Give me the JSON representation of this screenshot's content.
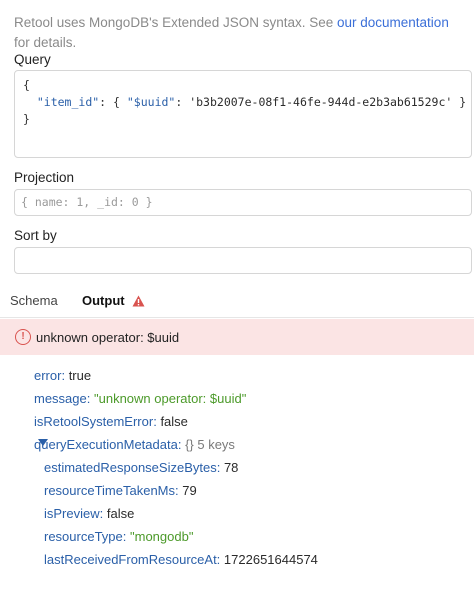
{
  "intro": {
    "text_before": "Retool uses MongoDB's Extended JSON syntax. See ",
    "link": "our documentation",
    "text_after": " for details."
  },
  "query": {
    "label": "Query",
    "lines": [
      "{",
      "  \"item_id\": { \"$uuid\": 'b3b2007e-08f1-46fe-944d-e2b3ab61529c' }",
      "}"
    ],
    "open_brace": "{",
    "key": "\"item_id\"",
    "colon_brace": ": { ",
    "op": "\"$uuid\"",
    "colon": ": ",
    "value": "'b3b2007e-08f1-46fe-944d-e2b3ab61529c'",
    "close_inner": " }",
    "close_brace": "}"
  },
  "projection": {
    "label": "Projection",
    "placeholder": "{ name: 1, _id: 0 }"
  },
  "sort": {
    "label": "Sort by",
    "value": ""
  },
  "tabs": {
    "schema": "Schema",
    "output": "Output"
  },
  "error": {
    "icon": "!",
    "message": "unknown operator: $uuid"
  },
  "output": {
    "error_key": "error:",
    "error_val": "true",
    "message_key": "message:",
    "message_val": "\"unknown operator: $uuid\"",
    "isRetool_key": "isRetoolSystemError:",
    "isRetool_val": "false",
    "qem_key": "queryExecutionMetadata:",
    "qem_meta": "{} 5 keys",
    "est_key": "estimatedResponseSizeBytes:",
    "est_val": "78",
    "rtt_key": "resourceTimeTakenMs:",
    "rtt_val": "79",
    "preview_key": "isPreview:",
    "preview_val": "false",
    "rtype_key": "resourceType:",
    "rtype_val": "\"mongodb\"",
    "lrfr_key": "lastReceivedFromResourceAt:",
    "lrfr_val": "1722651644574"
  },
  "colors": {
    "accent": "#3b6fd8",
    "error_bg": "#fbe4e4",
    "error_icon": "#d9534f",
    "key": "#2a5fa8",
    "string": "#4c9a2a"
  }
}
